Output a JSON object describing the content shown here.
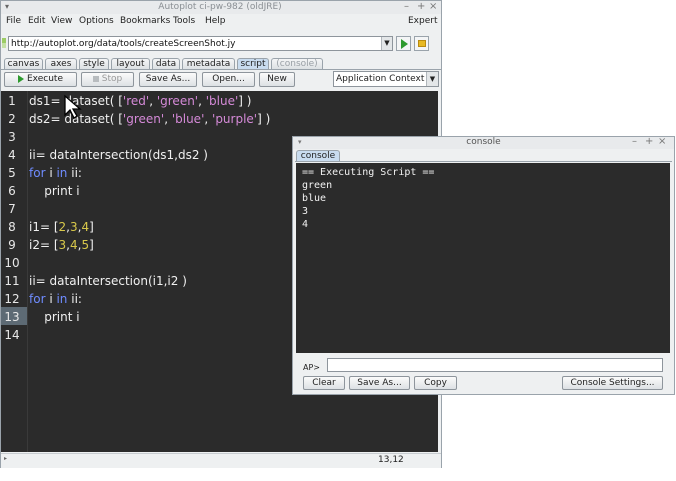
{
  "window": {
    "title": "Autoplot ci-pw-982 (oldJRE)",
    "controls": [
      "–",
      "+",
      "×"
    ]
  },
  "menubar": {
    "items": [
      "File",
      "Edit",
      "View",
      "Options",
      "Bookmarks",
      "Tools",
      "Help"
    ],
    "right": "Expert"
  },
  "address": {
    "value": "http://autoplot.org/data/tools/createScreenShot.jy"
  },
  "tabs": [
    "canvas",
    "axes",
    "style",
    "layout",
    "data",
    "metadata",
    "script",
    "(console)"
  ],
  "toolbar": {
    "execute": "Execute",
    "stop": "Stop",
    "save_as": "Save As...",
    "open": "Open...",
    "new": "New",
    "context": "Application Context"
  },
  "editor": {
    "line_numbers": [
      "1",
      "2",
      "3",
      "4",
      "5",
      "6",
      "7",
      "8",
      "9",
      "10",
      "11",
      "12",
      "13",
      "14"
    ],
    "current_line": 13,
    "status": "13,12",
    "code": [
      [
        {
          "t": "ds1= dataset( [",
          "c": "p"
        },
        {
          "t": "'red'",
          "c": "s"
        },
        {
          "t": ", ",
          "c": "p"
        },
        {
          "t": "'green'",
          "c": "s"
        },
        {
          "t": ", ",
          "c": "p"
        },
        {
          "t": "'blue'",
          "c": "s"
        },
        {
          "t": "] )",
          "c": "p"
        }
      ],
      [
        {
          "t": "ds2= dataset( [",
          "c": "p"
        },
        {
          "t": "'green'",
          "c": "s"
        },
        {
          "t": ", ",
          "c": "p"
        },
        {
          "t": "'blue'",
          "c": "s"
        },
        {
          "t": ", ",
          "c": "p"
        },
        {
          "t": "'purple'",
          "c": "s"
        },
        {
          "t": "] )",
          "c": "p"
        }
      ],
      [],
      [
        {
          "t": "ii= dataIntersection(ds1,ds2 )",
          "c": "p"
        }
      ],
      [
        {
          "t": "for",
          "c": "k"
        },
        {
          "t": " i ",
          "c": "p"
        },
        {
          "t": "in",
          "c": "k"
        },
        {
          "t": " ii:",
          "c": "p"
        }
      ],
      [
        {
          "t": "    print i",
          "c": "p"
        }
      ],
      [],
      [
        {
          "t": "i1= [",
          "c": "p"
        },
        {
          "t": "2",
          "c": "n"
        },
        {
          "t": ",",
          "c": "p"
        },
        {
          "t": "3",
          "c": "n"
        },
        {
          "t": ",",
          "c": "p"
        },
        {
          "t": "4",
          "c": "n"
        },
        {
          "t": "]",
          "c": "p"
        }
      ],
      [
        {
          "t": "i2= [",
          "c": "p"
        },
        {
          "t": "3",
          "c": "n"
        },
        {
          "t": ",",
          "c": "p"
        },
        {
          "t": "4",
          "c": "n"
        },
        {
          "t": ",",
          "c": "p"
        },
        {
          "t": "5",
          "c": "n"
        },
        {
          "t": "]",
          "c": "p"
        }
      ],
      [],
      [
        {
          "t": "ii= dataIntersection(i1,i2 )",
          "c": "p"
        }
      ],
      [
        {
          "t": "for",
          "c": "k"
        },
        {
          "t": " i ",
          "c": "p"
        },
        {
          "t": "in",
          "c": "k"
        },
        {
          "t": " ii:",
          "c": "p"
        }
      ],
      [
        {
          "t": "    print i",
          "c": "p"
        }
      ],
      []
    ]
  },
  "console": {
    "title": "console",
    "tab": "console",
    "output": [
      "== Executing Script ==",
      "green",
      "blue",
      "3",
      "4"
    ],
    "prompt": "AP>",
    "input_value": "",
    "buttons": {
      "clear": "Clear",
      "save_as": "Save As...",
      "copy": "Copy",
      "settings": "Console Settings..."
    }
  },
  "colors": {
    "editor_bg": "#2b2b2b",
    "gutter_bg": "#2b2b2b",
    "keyword": "#6f8cff",
    "string": "#d58ad8",
    "number": "#d8c84a"
  }
}
